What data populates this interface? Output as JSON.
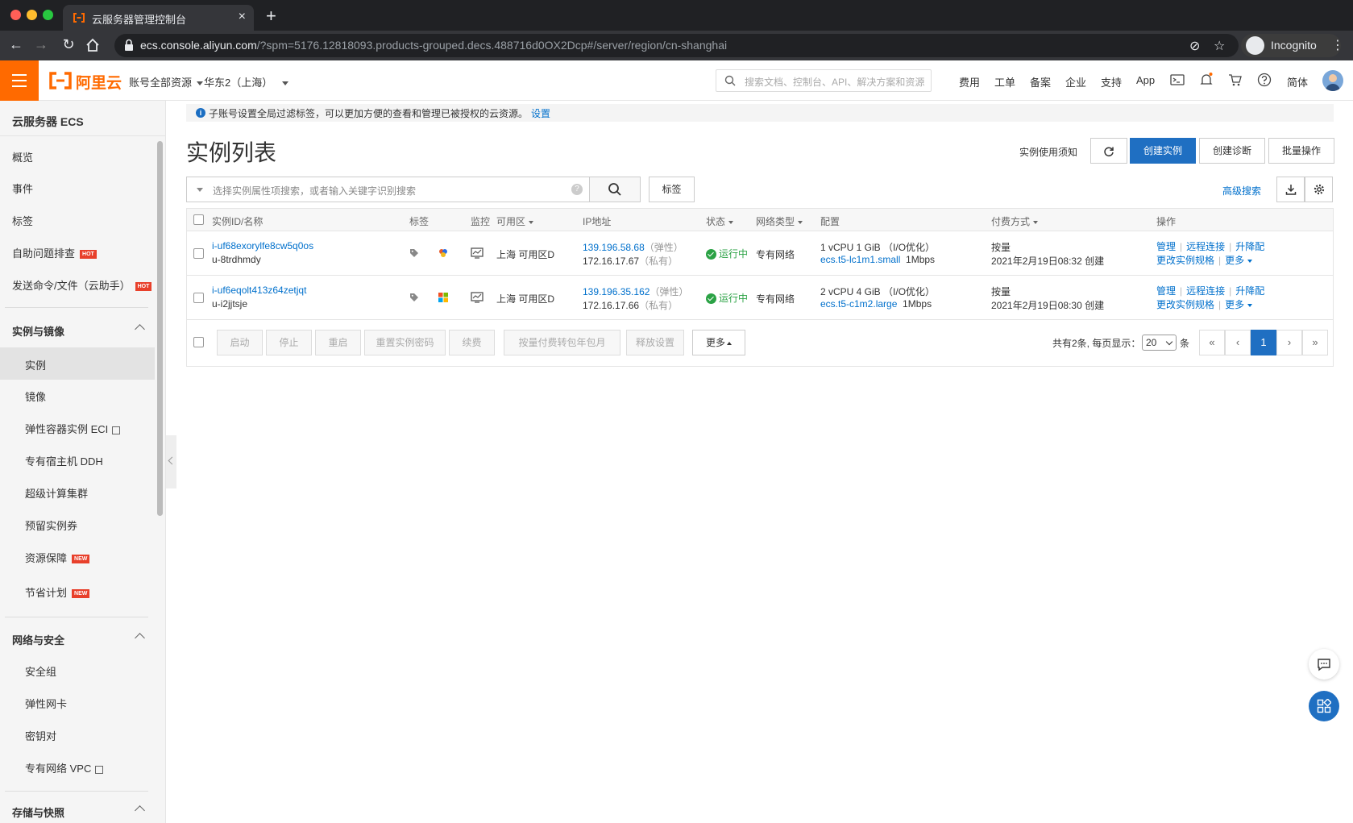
{
  "browser": {
    "tab_title": "云服务器管理控制台",
    "url_host": "ecs.console.aliyun.com",
    "url_rest": "/?spm=5176.12818093.products-grouped.decs.488716d0OX2Dcp#/server/region/cn-shanghai",
    "profile_label": "Incognito"
  },
  "topbar": {
    "logo_text": "阿里云",
    "resource_scope": "账号全部资源",
    "region": "华东2（上海）",
    "search_placeholder": "搜索文档、控制台、API、解决方案和资源",
    "links": [
      "费用",
      "工单",
      "备案",
      "企业",
      "支持",
      "App"
    ],
    "lang": "简体",
    "brand_color": "#ff6a00"
  },
  "sidebar": {
    "title": "云服务器 ECS",
    "top_items": [
      {
        "label": "概览"
      },
      {
        "label": "事件"
      },
      {
        "label": "标签"
      },
      {
        "label": "自助问题排查",
        "badge": "HOT"
      },
      {
        "label": "发送命令/文件（云助手）",
        "badge": "HOT"
      }
    ],
    "groups": [
      {
        "label": "实例与镜像",
        "items": [
          {
            "label": "实例"
          },
          {
            "label": "镜像"
          },
          {
            "label": "弹性容器实例 ECI"
          },
          {
            "label": "专有宿主机 DDH"
          },
          {
            "label": "超级计算集群"
          },
          {
            "label": "预留实例券"
          },
          {
            "label": "资源保障",
            "badge": "NEW"
          },
          {
            "label": "节省计划",
            "badge": "NEW"
          }
        ]
      },
      {
        "label": "网络与安全",
        "items": [
          {
            "label": "安全组"
          },
          {
            "label": "弹性网卡"
          },
          {
            "label": "密钥对"
          },
          {
            "label": "专有网络 VPC"
          }
        ]
      },
      {
        "label": "存储与快照",
        "items": []
      }
    ]
  },
  "main": {
    "notice": "子账号设置全局过滤标签，可以更加方便的查看和管理已被授权的云资源。",
    "notice_link": "设置",
    "title": "实例列表",
    "usage_link": "实例使用须知",
    "create_btn": "创建实例",
    "diagnose_btn": "创建诊断",
    "batch_btn": "批量操作",
    "search_placeholder": "选择实例属性项搜索，或者输入关键字识别搜索",
    "tag_btn": "标签",
    "adv_search": "高级搜索",
    "accent_color": "#1f6fc2"
  },
  "table": {
    "headers": {
      "id": "实例ID/名称",
      "tag": "标签",
      "monitor": "监控",
      "zone": "可用区",
      "ip": "IP地址",
      "status": "状态",
      "net": "网络类型",
      "config": "配置",
      "pay": "付费方式",
      "ops": "操作"
    },
    "rows": [
      {
        "id": "i-uf68exorylfe8cw5q0os",
        "name": "u-8trdhmdy",
        "zone": "上海 可用区D",
        "public_ip": "139.196.58.68",
        "public_ip_type": "（弹性）",
        "private_ip": "172.16.17.67",
        "private_ip_type": "（私有）",
        "status": "运行中",
        "net": "专有网络",
        "config": "1 vCPU 1 GiB （I/O优化）",
        "spec": "ecs.t5-lc1m1.small",
        "bandwidth": "1Mbps",
        "pay": "按量",
        "created": "2021年2月19日08:32 创建",
        "ops": {
          "manage": "管理",
          "remote": "远程连接",
          "upgrade": "升降配",
          "change_spec": "更改实例规格",
          "more": "更多"
        }
      },
      {
        "id": "i-uf6eqolt413z64zetjqt",
        "name": "u-i2jjtsje",
        "zone": "上海 可用区D",
        "public_ip": "139.196.35.162",
        "public_ip_type": "（弹性）",
        "private_ip": "172.16.17.66",
        "private_ip_type": "（私有）",
        "status": "运行中",
        "net": "专有网络",
        "config": "2 vCPU 4 GiB （I/O优化）",
        "spec": "ecs.t5-c1m2.large",
        "bandwidth": "1Mbps",
        "pay": "按量",
        "created": "2021年2月19日08:30 创建",
        "ops": {
          "manage": "管理",
          "remote": "远程连接",
          "upgrade": "升降配",
          "change_spec": "更改实例规格",
          "more": "更多"
        }
      }
    ],
    "footer": {
      "buttons": [
        "启动",
        "停止",
        "重启",
        "重置实例密码",
        "续费",
        "按量付费转包年包月",
        "释放设置"
      ],
      "more": "更多",
      "total": "共有2条, 每页显示：",
      "per_page": "20",
      "per_unit": "条",
      "pager": {
        "first": "«",
        "prev": "‹",
        "current": "1",
        "next": "›",
        "last": "»"
      }
    }
  }
}
